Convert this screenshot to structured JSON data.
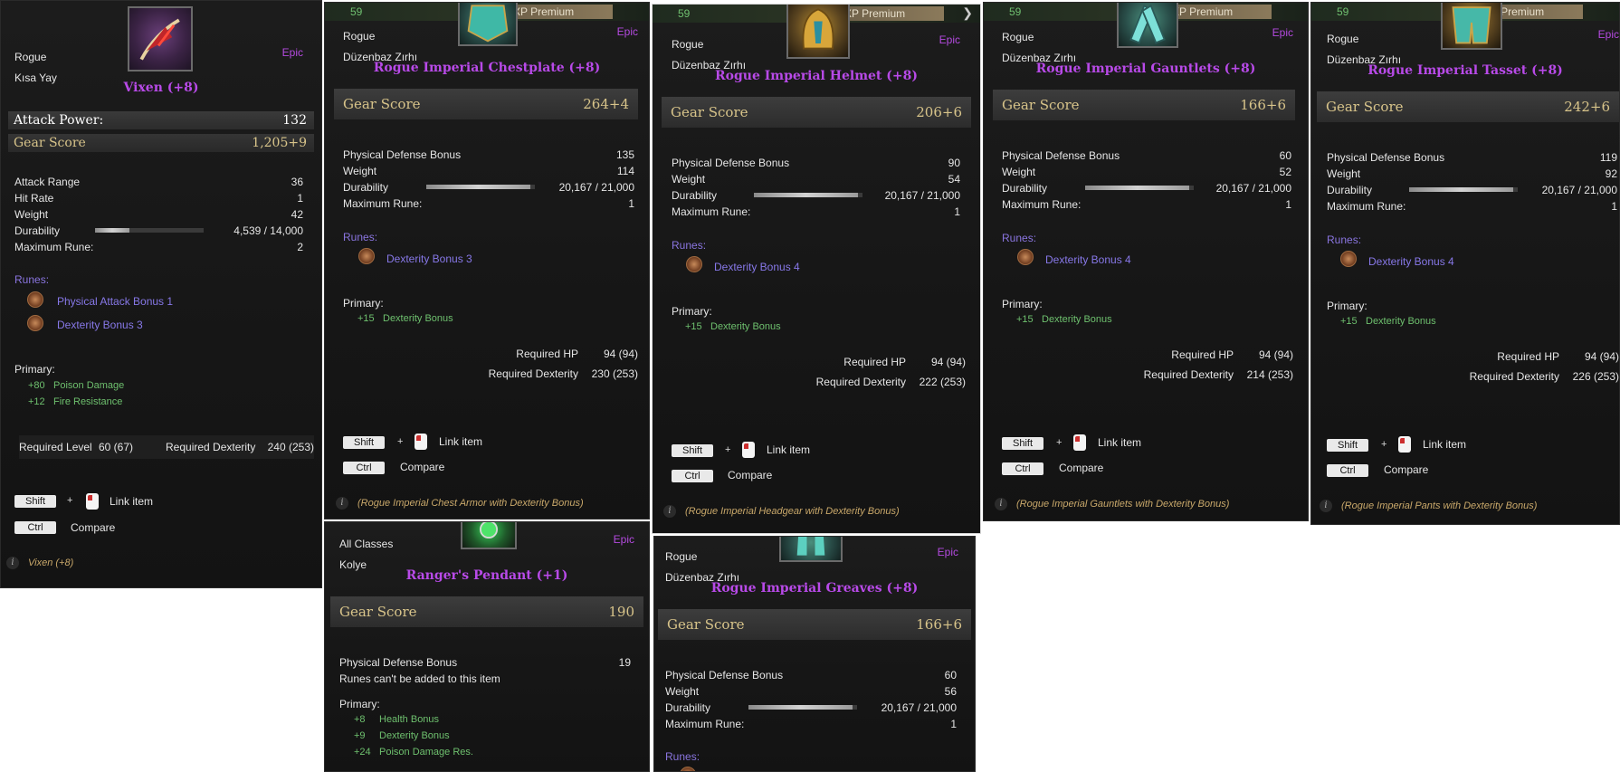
{
  "colors": {
    "epic": "#b44ae0",
    "gear_score": "#d8c48a",
    "bonus": "#6ec06e",
    "rune": "#8778e8",
    "desc": "#c9a86a"
  },
  "level": "59",
  "xp_label": "XP Premium",
  "controls": {
    "shift": "Shift",
    "ctrl": "Ctrl",
    "plus": "+",
    "link": "Link item",
    "compare": "Compare"
  },
  "vixen": {
    "class": "Rogue",
    "type": "Kısa Yay",
    "rarity": "Epic",
    "name": "Vixen (+8)",
    "attack_power_label": "Attack Power:",
    "attack_power": "132",
    "gs_label": "Gear Score",
    "gs": "1,205+9",
    "stats": [
      {
        "label": "Attack Range",
        "value": "36"
      },
      {
        "label": "Hit Rate",
        "value": "1"
      },
      {
        "label": "Weight",
        "value": "42"
      },
      {
        "label": "Durability",
        "value": "4,539 / 14,000",
        "fraction": 0.32
      },
      {
        "label": "Maximum Rune:",
        "value": "2"
      }
    ],
    "runes_label": "Runes:",
    "runes": [
      "Physical Attack Bonus 1",
      "Dexterity Bonus 3"
    ],
    "primary_label": "Primary:",
    "primary": [
      {
        "n": "+80",
        "t": "Poison Damage"
      },
      {
        "n": "+12",
        "t": "Fire Resistance"
      }
    ],
    "req_level_label": "Required Level",
    "req_level": "60 (67)",
    "req_dex_label": "Required Dexterity",
    "req_dex": "240 (253)",
    "desc": "Vixen (+8)",
    "icon": "bow-icon"
  },
  "chest": {
    "class": "Rogue",
    "type": "Düzenbaz Zırhı",
    "rarity": "Epic",
    "name": "Rogue Imperial Chestplate (+8)",
    "gs_label": "Gear Score",
    "gs": "264+4",
    "stats": [
      {
        "label": "Physical Defense Bonus",
        "value": "135"
      },
      {
        "label": "Weight",
        "value": "114"
      },
      {
        "label": "Durability",
        "value": "20,167 / 21,000",
        "fraction": 0.96
      },
      {
        "label": "Maximum Rune:",
        "value": "1"
      }
    ],
    "runes_label": "Runes:",
    "runes": [
      "Dexterity Bonus 3"
    ],
    "primary_label": "Primary:",
    "primary": [
      {
        "n": "+15",
        "t": "Dexterity Bonus"
      }
    ],
    "req_hp_label": "Required HP",
    "req_hp": "94 (94)",
    "req_dex_label": "Required Dexterity",
    "req_dex": "230 (253)",
    "desc": "(Rogue Imperial Chest Armor with Dexterity Bonus)",
    "icon": "chestplate-icon"
  },
  "helmet": {
    "class": "Rogue",
    "type": "Düzenbaz Zırhı",
    "rarity": "Epic",
    "name": "Rogue Imperial Helmet (+8)",
    "gs_label": "Gear Score",
    "gs": "206+6",
    "stats": [
      {
        "label": "Physical Defense Bonus",
        "value": "90"
      },
      {
        "label": "Weight",
        "value": "54"
      },
      {
        "label": "Durability",
        "value": "20,167 / 21,000",
        "fraction": 0.96
      },
      {
        "label": "Maximum Rune:",
        "value": "1"
      }
    ],
    "runes_label": "Runes:",
    "runes": [
      "Dexterity Bonus 4"
    ],
    "primary_label": "Primary:",
    "primary": [
      {
        "n": "+15",
        "t": "Dexterity Bonus"
      }
    ],
    "req_hp_label": "Required HP",
    "req_hp": "94 (94)",
    "req_dex_label": "Required Dexterity",
    "req_dex": "222 (253)",
    "desc": "(Rogue Imperial Headgear with Dexterity Bonus)",
    "icon": "helmet-icon"
  },
  "gauntlets": {
    "class": "Rogue",
    "type": "Düzenbaz Zırhı",
    "rarity": "Epic",
    "name": "Rogue Imperial Gauntlets (+8)",
    "gs_label": "Gear Score",
    "gs": "166+6",
    "stats": [
      {
        "label": "Physical Defense Bonus",
        "value": "60"
      },
      {
        "label": "Weight",
        "value": "52"
      },
      {
        "label": "Durability",
        "value": "20,167 / 21,000",
        "fraction": 0.96
      },
      {
        "label": "Maximum Rune:",
        "value": "1"
      }
    ],
    "runes_label": "Runes:",
    "runes": [
      "Dexterity Bonus 4"
    ],
    "primary_label": "Primary:",
    "primary": [
      {
        "n": "+15",
        "t": "Dexterity Bonus"
      }
    ],
    "req_hp_label": "Required HP",
    "req_hp": "94 (94)",
    "req_dex_label": "Required Dexterity",
    "req_dex": "214 (253)",
    "desc": "(Rogue Imperial Gauntlets with Dexterity Bonus)",
    "icon": "gauntlets-icon"
  },
  "tasset": {
    "class": "Rogue",
    "type": "Düzenbaz Zırhı",
    "rarity": "Epic",
    "name": "Rogue Imperial Tasset (+8)",
    "gs_label": "Gear Score",
    "gs": "242+6",
    "stats": [
      {
        "label": "Physical Defense Bonus",
        "value": "119"
      },
      {
        "label": "Weight",
        "value": "92"
      },
      {
        "label": "Durability",
        "value": "20,167 / 21,000",
        "fraction": 0.96
      },
      {
        "label": "Maximum Rune:",
        "value": "1"
      }
    ],
    "runes_label": "Runes:",
    "runes": [
      "Dexterity Bonus 4"
    ],
    "primary_label": "Primary:",
    "primary": [
      {
        "n": "+15",
        "t": "Dexterity Bonus"
      }
    ],
    "req_hp_label": "Required HP",
    "req_hp": "94 (94)",
    "req_dex_label": "Required Dexterity",
    "req_dex": "226 (253)",
    "desc": "(Rogue Imperial Pants with Dexterity Bonus)",
    "icon": "tasset-icon"
  },
  "pendant": {
    "class": "All Classes",
    "type": "Kolye",
    "rarity": "Epic",
    "name": "Ranger's Pendant (+1)",
    "gs_label": "Gear Score",
    "gs": "190",
    "stats": [
      {
        "label": "Physical Defense Bonus",
        "value": "19"
      }
    ],
    "note": "Runes can't be added to this item",
    "primary_label": "Primary:",
    "primary": [
      {
        "n": "+8",
        "t": "Health Bonus"
      },
      {
        "n": "+9",
        "t": "Dexterity Bonus"
      },
      {
        "n": "+24",
        "t": "Poison Damage Res."
      }
    ],
    "icon": "pendant-icon"
  },
  "greaves": {
    "class": "Rogue",
    "type": "Düzenbaz Zırhı",
    "rarity": "Epic",
    "name": "Rogue Imperial Greaves (+8)",
    "gs_label": "Gear Score",
    "gs": "166+6",
    "stats": [
      {
        "label": "Physical Defense Bonus",
        "value": "60"
      },
      {
        "label": "Weight",
        "value": "56"
      },
      {
        "label": "Durability",
        "value": "20,167 / 21,000",
        "fraction": 0.96
      },
      {
        "label": "Maximum Rune:",
        "value": "1"
      }
    ],
    "runes_label": "Runes:",
    "icon": "greaves-icon"
  }
}
